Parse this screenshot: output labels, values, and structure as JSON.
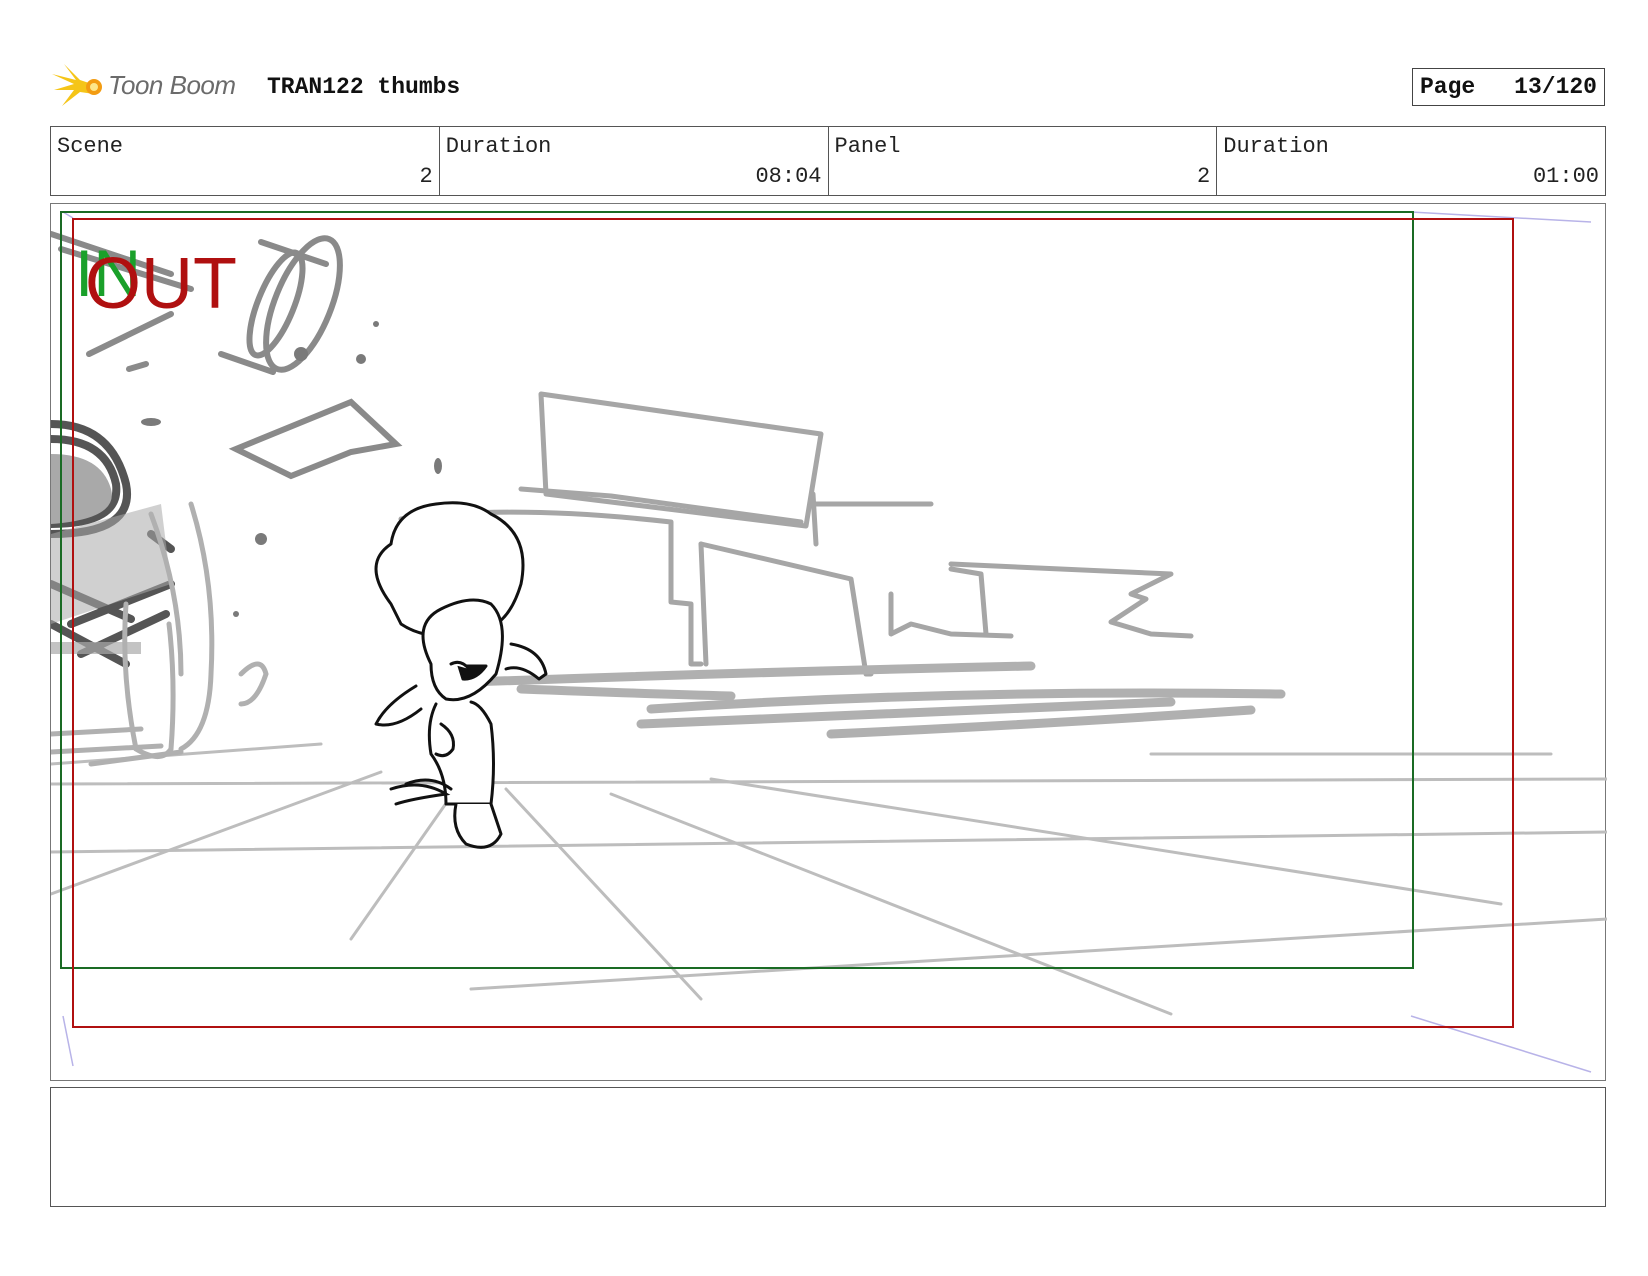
{
  "header": {
    "logo_text": "Toon Boom",
    "title": "TRAN122 thumbs",
    "page_label": "Page",
    "page_value": "13/120"
  },
  "info": {
    "scene_label": "Scene",
    "scene_value": "2",
    "scene_duration_label": "Duration",
    "scene_duration_value": "08:04",
    "panel_label": "Panel",
    "panel_value": "2",
    "panel_duration_label": "Duration",
    "panel_duration_value": "01:00"
  },
  "frame": {
    "in_label": "IN",
    "out_label": "OUT",
    "in_color": "#1a8a2a",
    "out_color": "#b01010"
  },
  "notes": {
    "text": ""
  }
}
